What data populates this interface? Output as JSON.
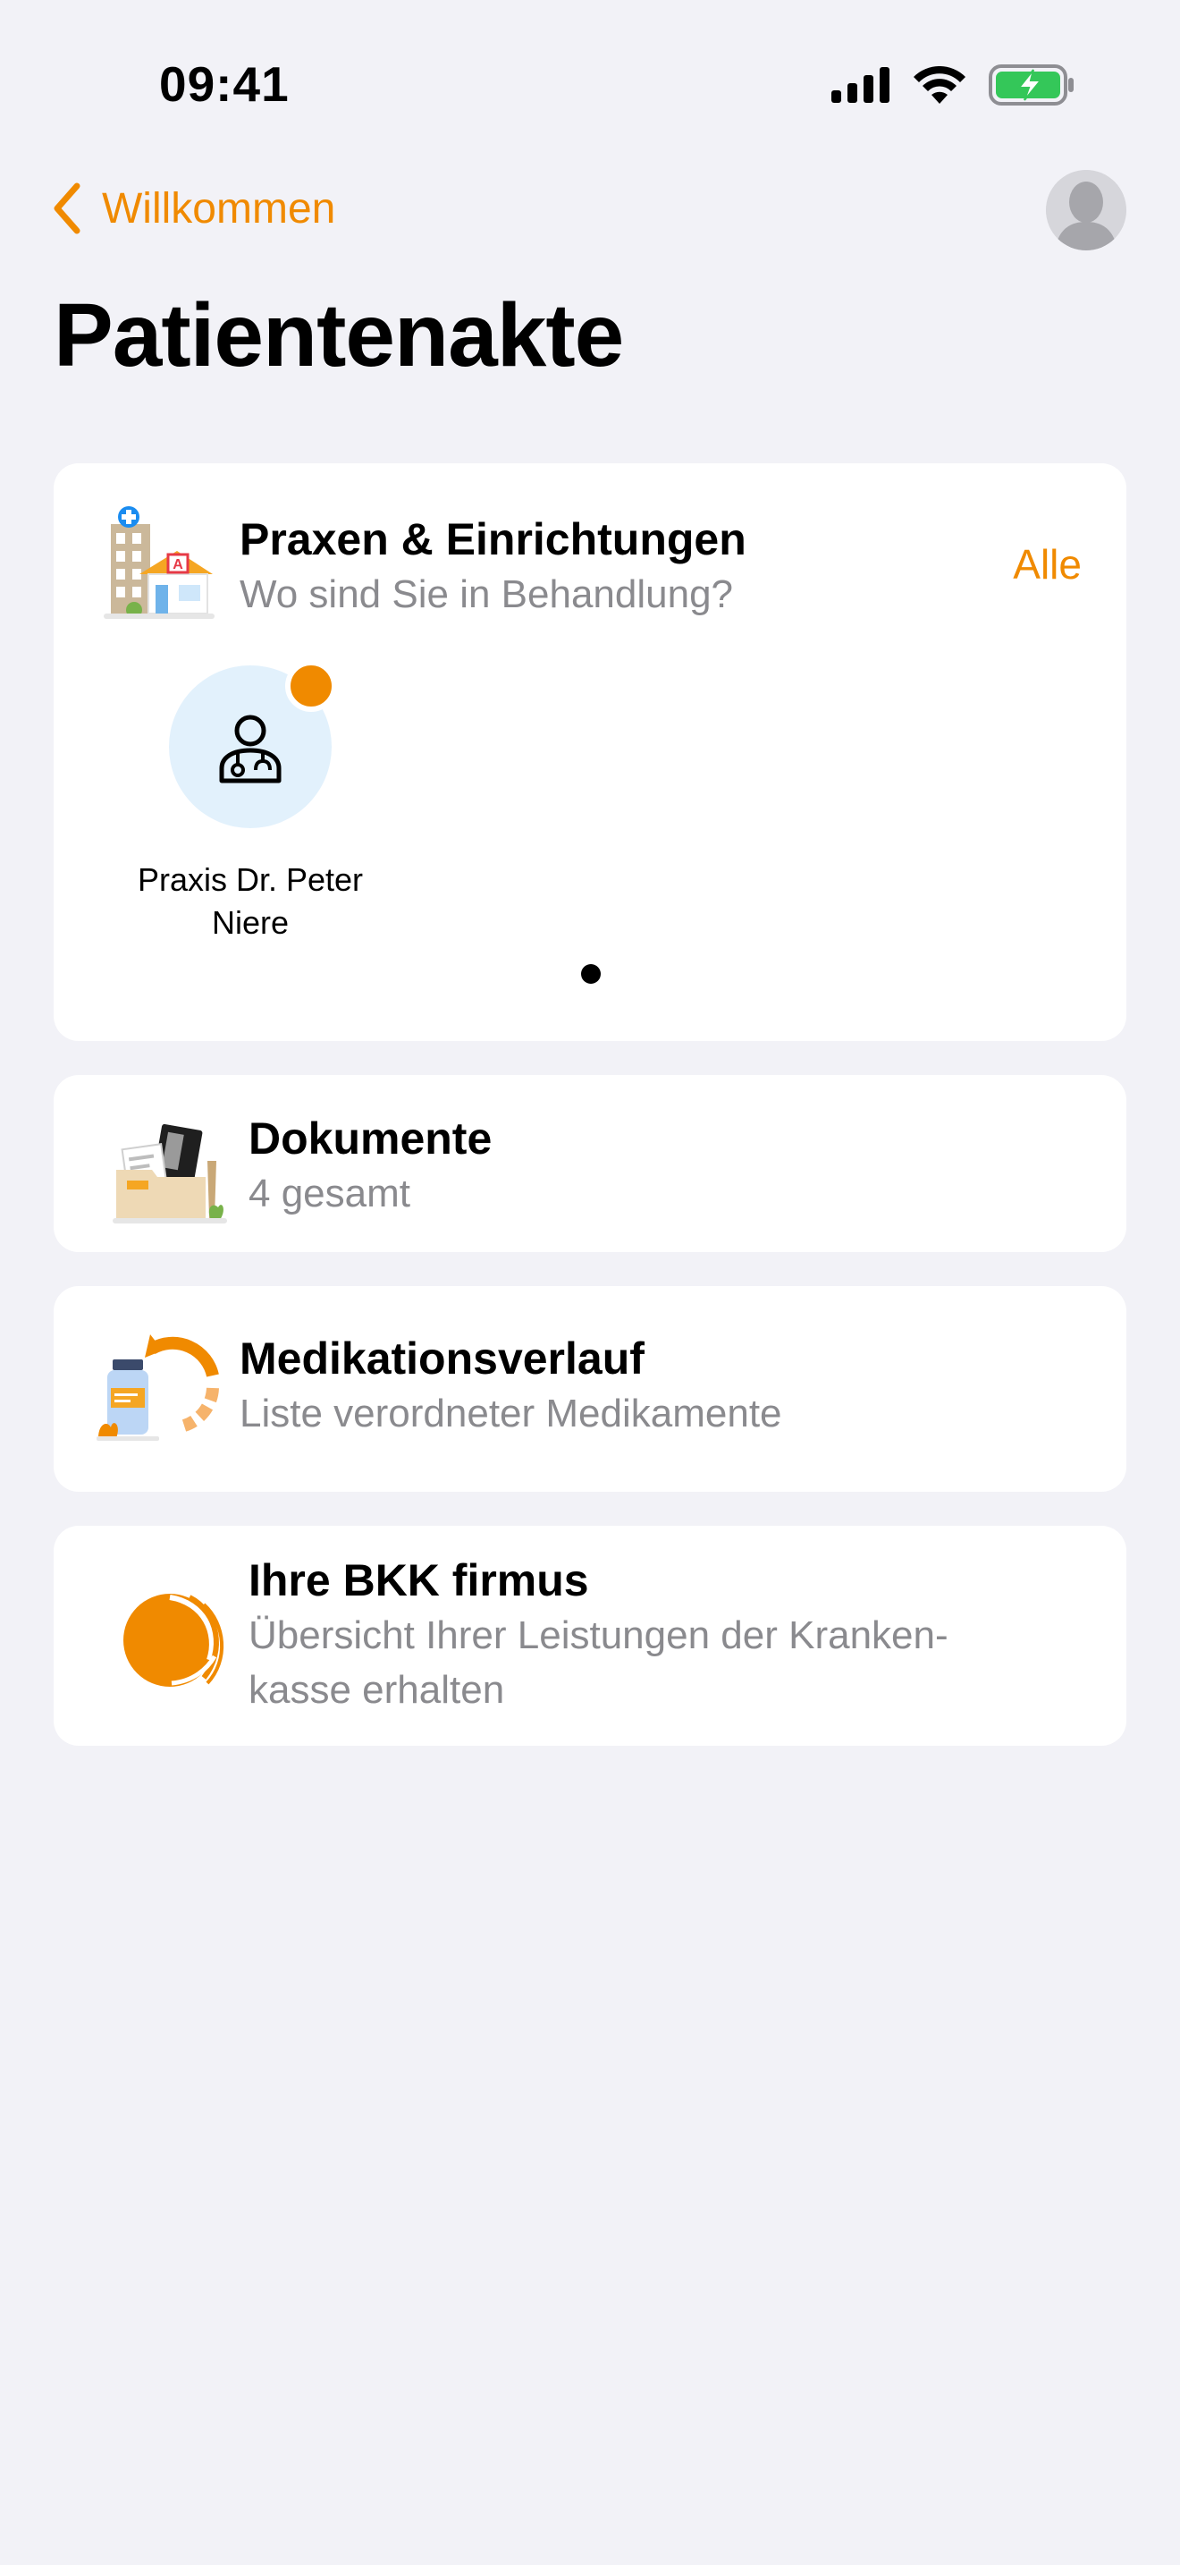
{
  "status_bar": {
    "time": "09:41",
    "icons": [
      "signal-icon",
      "wifi-icon",
      "battery-charging-icon"
    ]
  },
  "nav": {
    "back_label": "Willkommen",
    "back_icon": "chevron-left-icon",
    "avatar_icon": "user-avatar-icon"
  },
  "page": {
    "title": "Patientenakte"
  },
  "colors": {
    "accent": "#f08a00",
    "background": "#f2f2f7",
    "card": "#ffffff",
    "secondary_text": "#8a8a8e",
    "practice_circle": "#e2f1fc"
  },
  "praxen": {
    "title": "Praxen & Einrichtungen",
    "subtitle": "Wo sind Sie in Behandlung?",
    "all_label": "Alle",
    "icon": "clinic-building-icon",
    "items": [
      {
        "name": "Praxis Dr. Peter Niere",
        "icon": "doctor-icon",
        "has_notification": true
      }
    ],
    "page_indicator": {
      "pages": 1,
      "current": 1
    }
  },
  "documents": {
    "title": "Dokumente",
    "subtitle": "4 gesamt",
    "icon": "document-folder-icon"
  },
  "medication": {
    "title": "Medikationsverlauf",
    "subtitle": "Liste verordneter Medikamente",
    "icon": "medication-history-icon"
  },
  "bkk": {
    "title": "Ihre BKK firmus",
    "subtitle_line1": "Übersicht Ihrer Leistungen der Kranken-",
    "subtitle_line2": "kasse erhalten",
    "icon": "bkk-firmus-logo-icon"
  }
}
